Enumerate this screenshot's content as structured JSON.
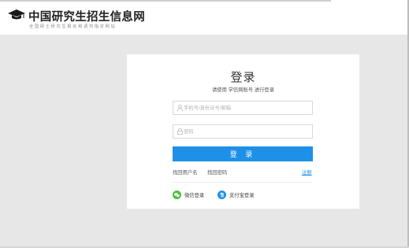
{
  "header": {
    "site_title": "中国研究生招生信息网",
    "site_subtitle": "全国硕士研究生报名和调剂指定网站",
    "logo_icon": "graduation-cap-icon"
  },
  "login": {
    "title": "登录",
    "hint": "请使用 学信网账号 进行登录",
    "username_placeholder": "手机号/身份证号/邮箱",
    "password_placeholder": "密码",
    "login_button": "登 录",
    "recover_username": "找回用户名",
    "recover_password": "找回密码",
    "register": "注册",
    "wechat_login": "微信登录",
    "alipay_login": "支付宝登录"
  },
  "colors": {
    "accent": "#1e90e8",
    "wechat": "#4cbf3a",
    "alipay": "#1e90e8",
    "background": "#e7e7e7"
  }
}
